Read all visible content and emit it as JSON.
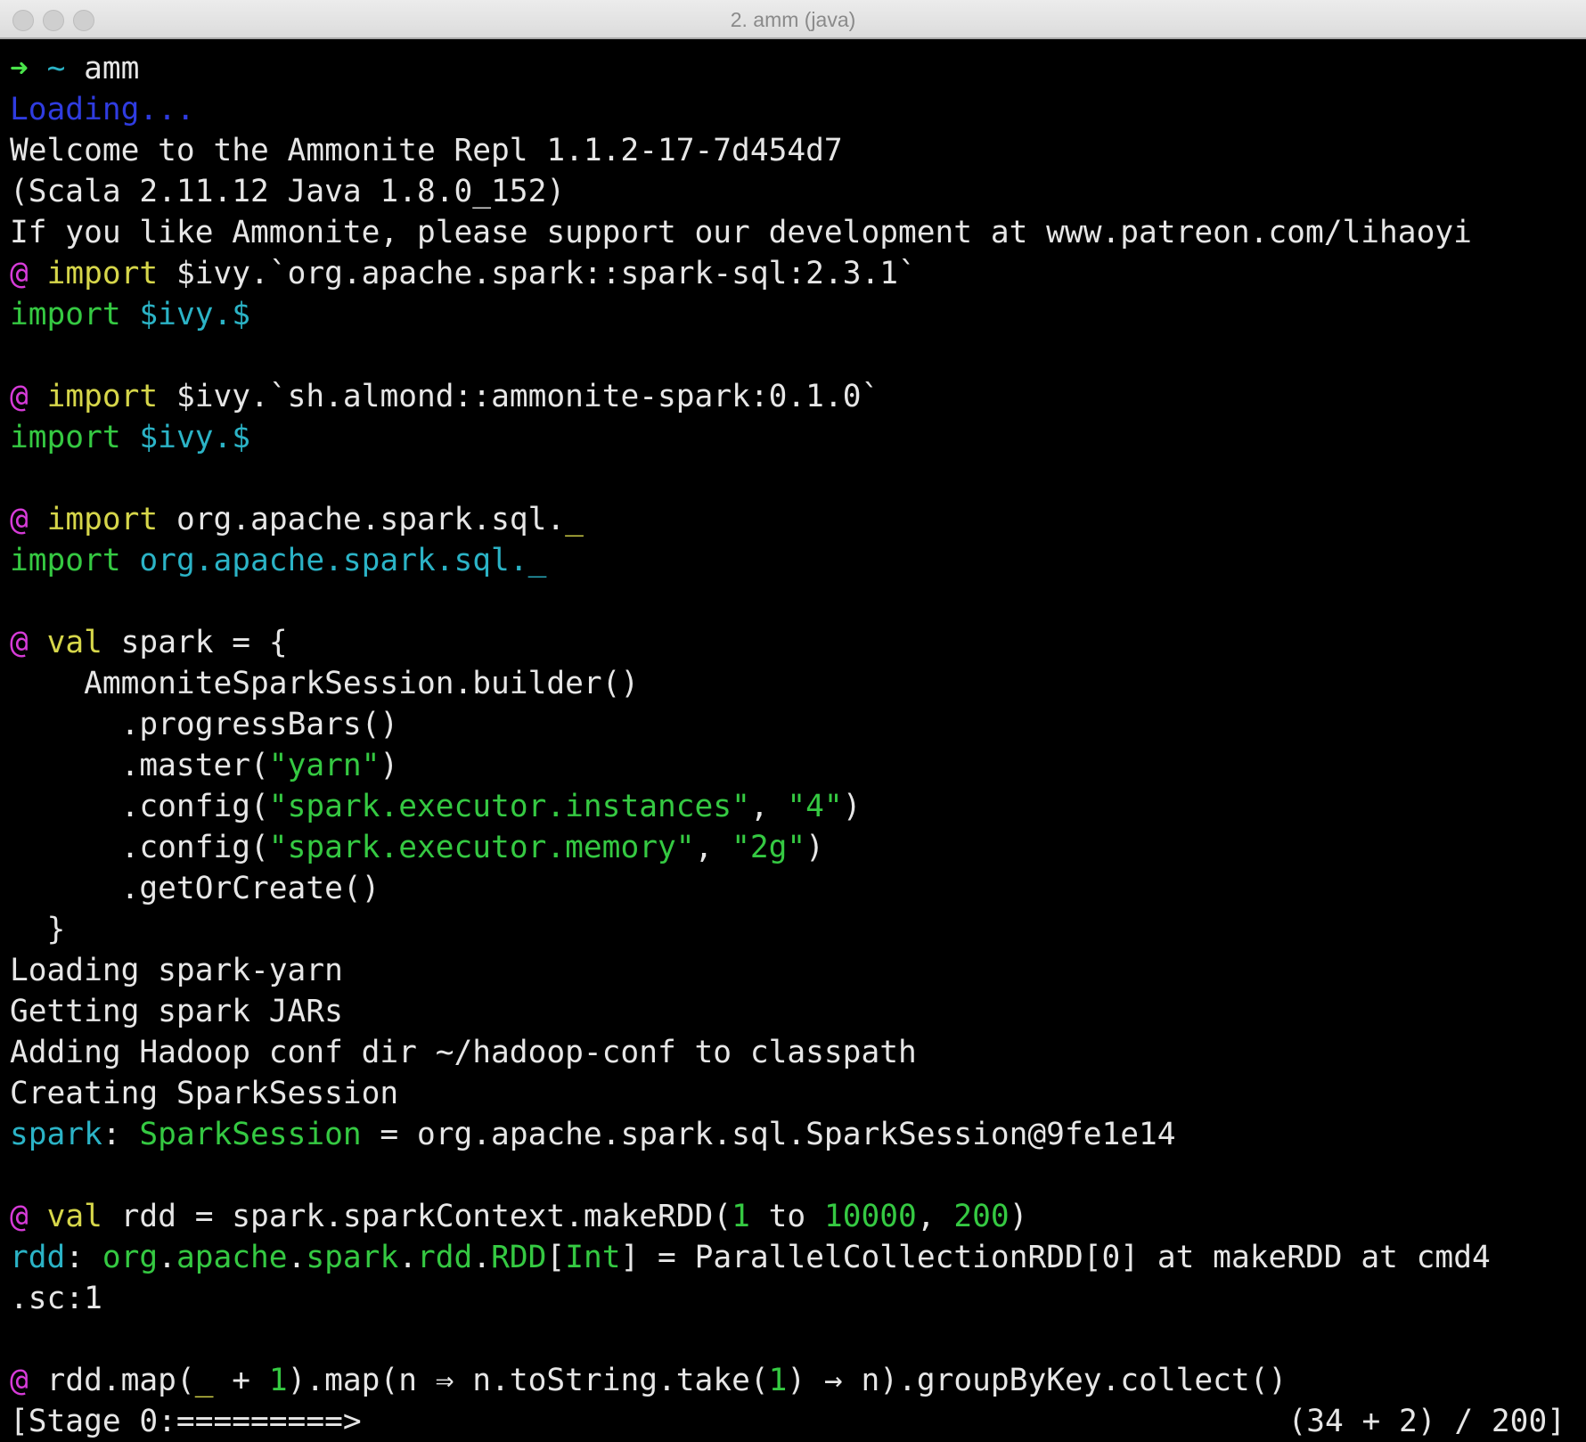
{
  "window": {
    "title": "2. amm (java)"
  },
  "colors": {
    "background": "#000000",
    "text": "#e6e6e6",
    "prompt_at": "#d63bd8",
    "keyword": "#d6d64a",
    "string_number": "#35c942",
    "identifier": "#2bb3c6",
    "loading": "#2f3ce0",
    "prompt_arrow": "#4ae34a"
  },
  "terminal": {
    "prompt_arrow": "➜",
    "prompt_tilde": "~",
    "prompt_command": " amm",
    "loading": "Loading...",
    "welcome": "Welcome to the Ammonite Repl 1.1.2-17-7d454d7",
    "versions": "(Scala 2.11.12 Java 1.8.0_152)",
    "support": "If you like Ammonite, please support our development at www.patreon.com/lihaoyi",
    "at": "@",
    "kw_import": "import",
    "kw_val": "val",
    "cmd1_rest": "$ivy.`org.apache.spark::spark-sql:2.3.1`",
    "ivy_result": "$ivy.$",
    "cmd2_rest": "$ivy.`sh.almond::ammonite-spark:0.1.0`",
    "cmd3_rest": "org.apache.spark.sql.",
    "underscore": "_",
    "cmd3_result": "org.apache.spark.sql._",
    "cmd4_head": "spark = {",
    "b1": "    AmmoniteSparkSession.builder()",
    "b2": "      .progressBars()",
    "b3_pre": "      .master(",
    "b3_str": "\"yarn\"",
    "b3_post": ")",
    "b4_pre": "      .config(",
    "b4_str1": "\"spark.executor.instances\"",
    "b4_mid": ", ",
    "b4_str2": "\"4\"",
    "b4_post": ")",
    "b5_pre": "      .config(",
    "b5_str1": "\"spark.executor.memory\"",
    "b5_mid": ", ",
    "b5_str2": "\"2g\"",
    "b5_post": ")",
    "b6": "      .getOrCreate()",
    "b7": "  }",
    "log1": "Loading spark-yarn",
    "log2": "Getting spark JARs",
    "log3": "Adding Hadoop conf dir ~/hadoop-conf to classpath",
    "log4": "Creating SparkSession",
    "spark_name": "spark",
    "colon": ": ",
    "spark_type": "SparkSession",
    "spark_value": " = org.apache.spark.sql.SparkSession@9fe1e14",
    "cmd5_pre": "rdd = spark.sparkContext.makeRDD(",
    "cmd5_n1": "1",
    "cmd5_to": " to ",
    "cmd5_n2": "10000",
    "cmd5_comma": ", ",
    "cmd5_n3": "200",
    "cmd5_post": ")",
    "rdd_name": "rdd",
    "rdd_t1": "org",
    "dot": ".",
    "rdd_t2": "apache",
    "rdd_t3": "spark",
    "rdd_t4": "rdd",
    "rdd_t5": "RDD",
    "lbr": "[",
    "rdd_t6": "Int",
    "rbr": "]",
    "rdd_value": " = ParallelCollectionRDD[0] at makeRDD at cmd4",
    "rdd_wrap": ".sc:1",
    "cmd6_pre": " rdd.map(",
    "cmd6_plus": " + ",
    "cmd6_n1": "1",
    "cmd6_mid": ").map(n ⇒ n.toString.take(",
    "cmd6_n2": "1",
    "cmd6_post": ") → n).groupByKey.collect()",
    "stage_bar": "[Stage 0:=========>",
    "stage_count": "(34 + 2) / 200]"
  }
}
